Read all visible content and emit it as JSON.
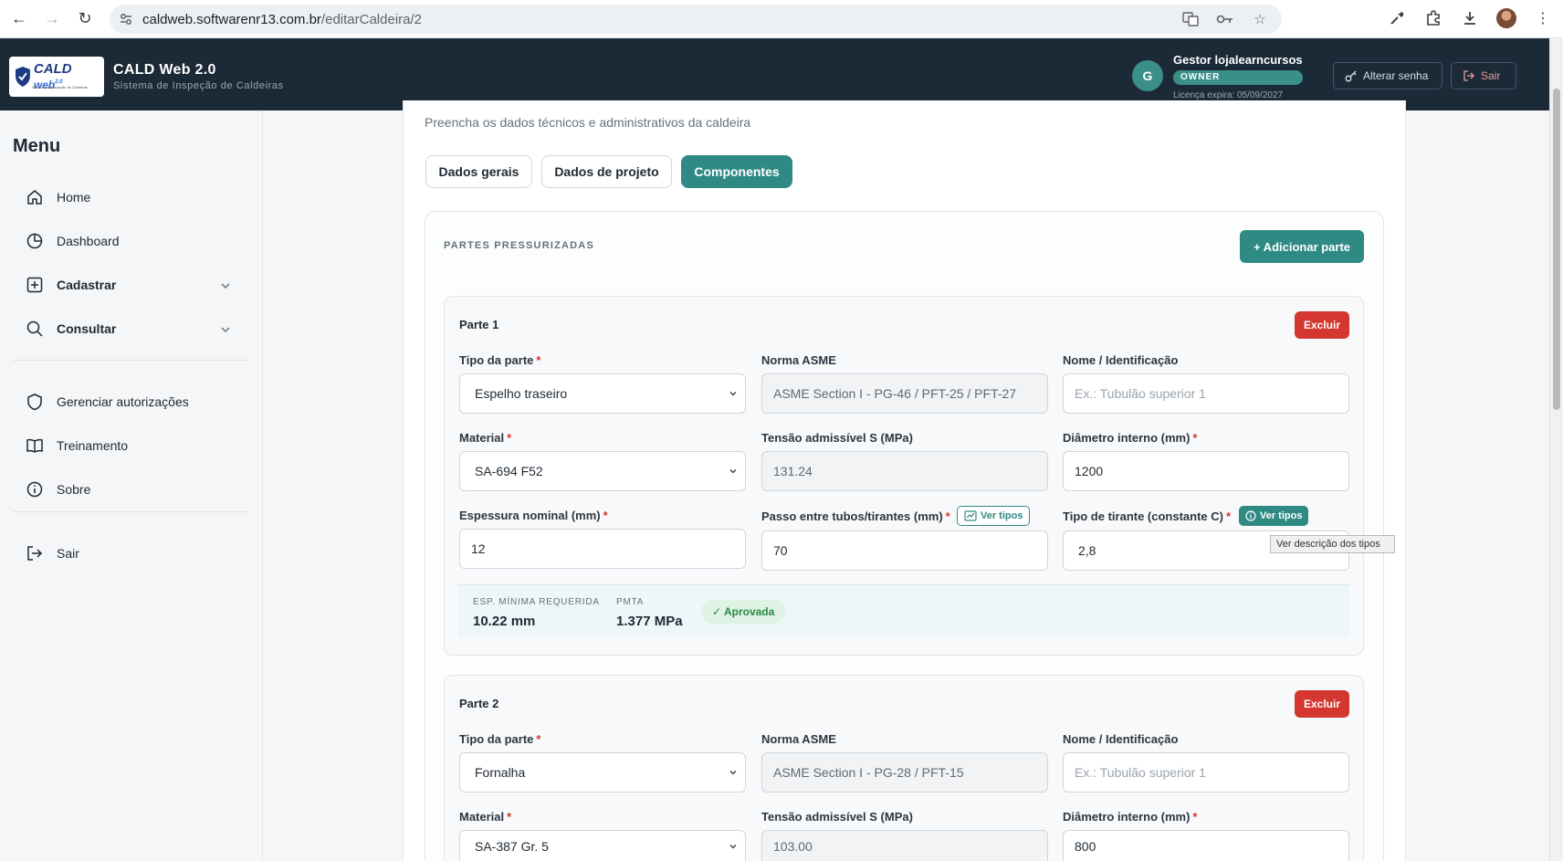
{
  "browser": {
    "url_domain": "caldweb.softwarenr13.com.br",
    "url_path": "/editarCaldeira/2"
  },
  "header": {
    "app_name": "CALD Web 2.0",
    "app_subtitle": "Sistema de Inspeção de Caldeiras",
    "logo_text": "CALD",
    "logo_web": "web",
    "logo_version": "2.0",
    "logo_tagline": "Sistema de Inspeção de Caldeiras",
    "user_initial": "G",
    "user_name": "Gestor lojalearncursos",
    "role": "OWNER",
    "license": "Licença expira: 05/09/2027",
    "change_password": "Alterar senha",
    "logout": "Sair"
  },
  "sidebar": {
    "title": "Menu",
    "items": [
      {
        "label": "Home",
        "icon": "home-icon"
      },
      {
        "label": "Dashboard",
        "icon": "pie-chart-icon"
      },
      {
        "label": "Cadastrar",
        "icon": "plus-square-icon"
      },
      {
        "label": "Consultar",
        "icon": "search-icon"
      },
      {
        "label": "Gerenciar autorizações",
        "icon": "shield-icon"
      },
      {
        "label": "Treinamento",
        "icon": "book-icon"
      },
      {
        "label": "Sobre",
        "icon": "info-icon"
      },
      {
        "label": "Sair",
        "icon": "logout-icon"
      }
    ]
  },
  "page": {
    "description": "Preencha os dados técnicos e administrativos da caldeira",
    "tabs": [
      "Dados gerais",
      "Dados de projeto",
      "Componentes"
    ],
    "active_tab": "Componentes",
    "section_title": "PARTES PRESSURIZADAS",
    "add_part": "+ Adicionar parte",
    "delete_label": "Excluir",
    "tooltip": "Ver descrição dos tipos"
  },
  "part1": {
    "title": "Parte 1",
    "labels": {
      "tipo": "Tipo da parte",
      "norma": "Norma ASME",
      "nome": "Nome / Identificação",
      "material": "Material",
      "tensao": "Tensão admissível S (MPa)",
      "diametro": "Diâmetro interno (mm)",
      "espessura": "Espessura nominal (mm)",
      "passo": "Passo entre tubos/tirantes (mm)",
      "tirante": "Tipo de tirante (constante C)"
    },
    "ver_tipos": "Ver tipos",
    "values": {
      "tipo": "Espelho traseiro",
      "norma": "ASME Section I - PG-46 / PFT-25 / PFT-27",
      "nome_placeholder": "Ex.: Tubulão superior 1",
      "material": "SA-694 F52",
      "tensao": "131.24",
      "diametro": "1200",
      "espessura": "12",
      "passo": "70",
      "tirante": "2,8"
    },
    "results": {
      "esp_label": "ESP. MÍNIMA REQUERIDA",
      "esp_value": "10.22 mm",
      "pmta_label": "PMTA",
      "pmta_value": "1.377 MPa",
      "status": "✓ Aprovada"
    }
  },
  "part2": {
    "title": "Parte 2",
    "values": {
      "tipo": "Fornalha",
      "norma": "ASME Section I - PG-28 / PFT-15",
      "nome_placeholder": "Ex.: Tubulão superior 1",
      "material": "SA-387 Gr. 5",
      "tensao": "103.00",
      "diametro": "800"
    }
  }
}
